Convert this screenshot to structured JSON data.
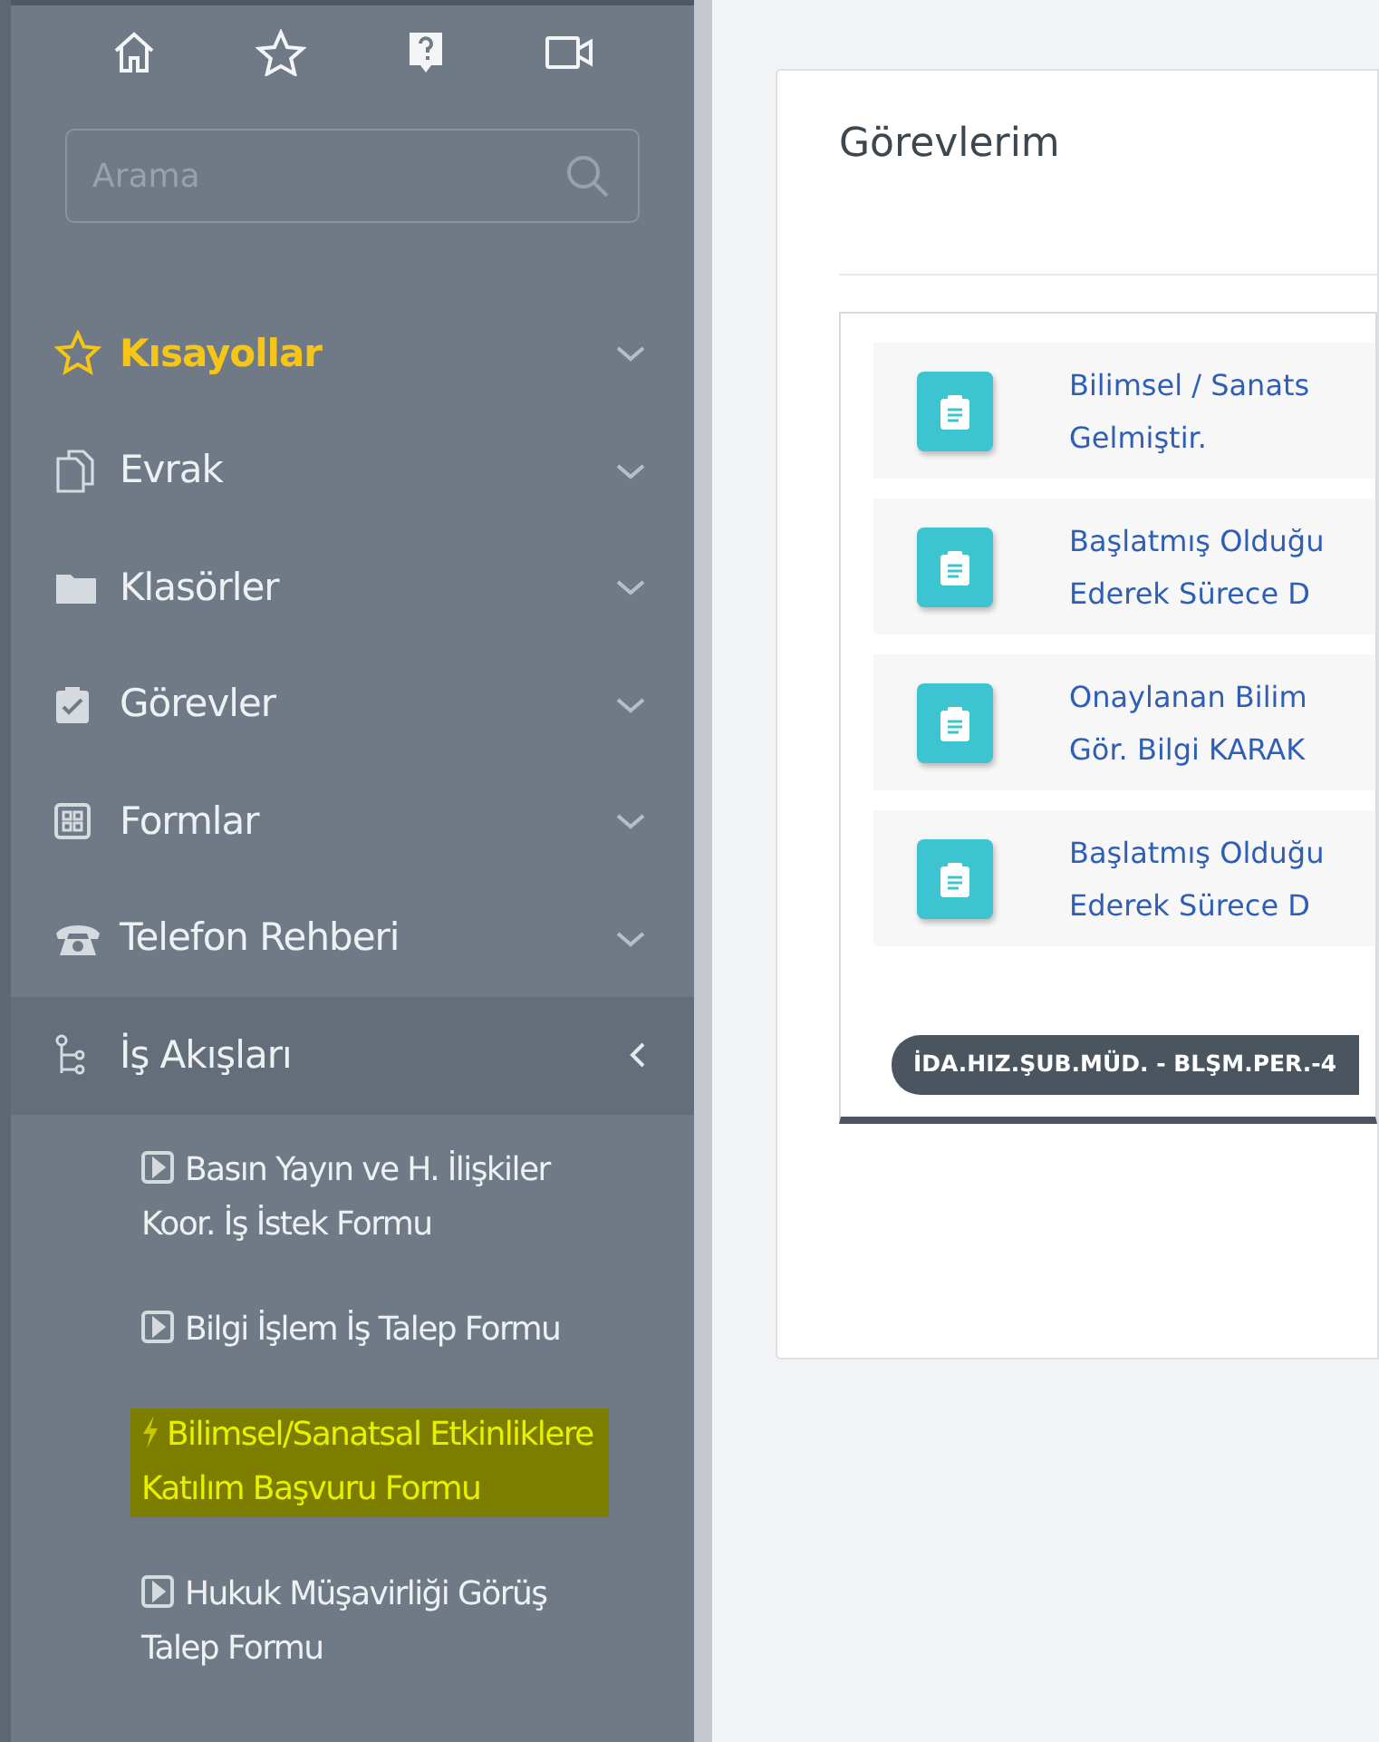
{
  "search": {
    "placeholder": "Arama"
  },
  "menu": [
    {
      "label": "Kısayollar",
      "emphasized": true,
      "expanded": false
    },
    {
      "label": "Evrak",
      "emphasized": false,
      "expanded": false
    },
    {
      "label": "Klasörler",
      "emphasized": false,
      "expanded": false
    },
    {
      "label": "Görevler",
      "emphasized": false,
      "expanded": false
    },
    {
      "label": "Formlar",
      "emphasized": false,
      "expanded": false
    },
    {
      "label": "Telefon Rehberi",
      "emphasized": false,
      "expanded": false
    },
    {
      "label": "İş Akışları",
      "emphasized": false,
      "expanded": true,
      "children": [
        {
          "label": "Basın Yayın ve H. İlişkiler Koor. İş İstek Formu",
          "highlighted": false
        },
        {
          "label": "Bilgi İşlem İş Talep Formu",
          "highlighted": false
        },
        {
          "label": "Bilimsel/Sanatsal Etkinliklere Katılım Başvuru Formu",
          "highlighted": true
        },
        {
          "label": "Hukuk Müşavirliği Görüş Talep Formu",
          "highlighted": false
        }
      ]
    }
  ],
  "panel": {
    "title": "Görevlerim",
    "tasks": [
      {
        "line_1": "Bilimsel / Sanats",
        "line_2": "Gelmiştir."
      },
      {
        "line_1": "Başlatmış Olduğu",
        "line_2": "Ederek Sürece D"
      },
      {
        "line_1": "Onaylanan Bilim",
        "line_2": "Gör. Bilgi KARAK"
      },
      {
        "line_1": "Başlatmış Olduğu",
        "line_2": "Ederek Sürece D"
      }
    ],
    "badge": "İDA.HIZ.ŞUB.MÜD. - BLŞM.PER.-4"
  }
}
